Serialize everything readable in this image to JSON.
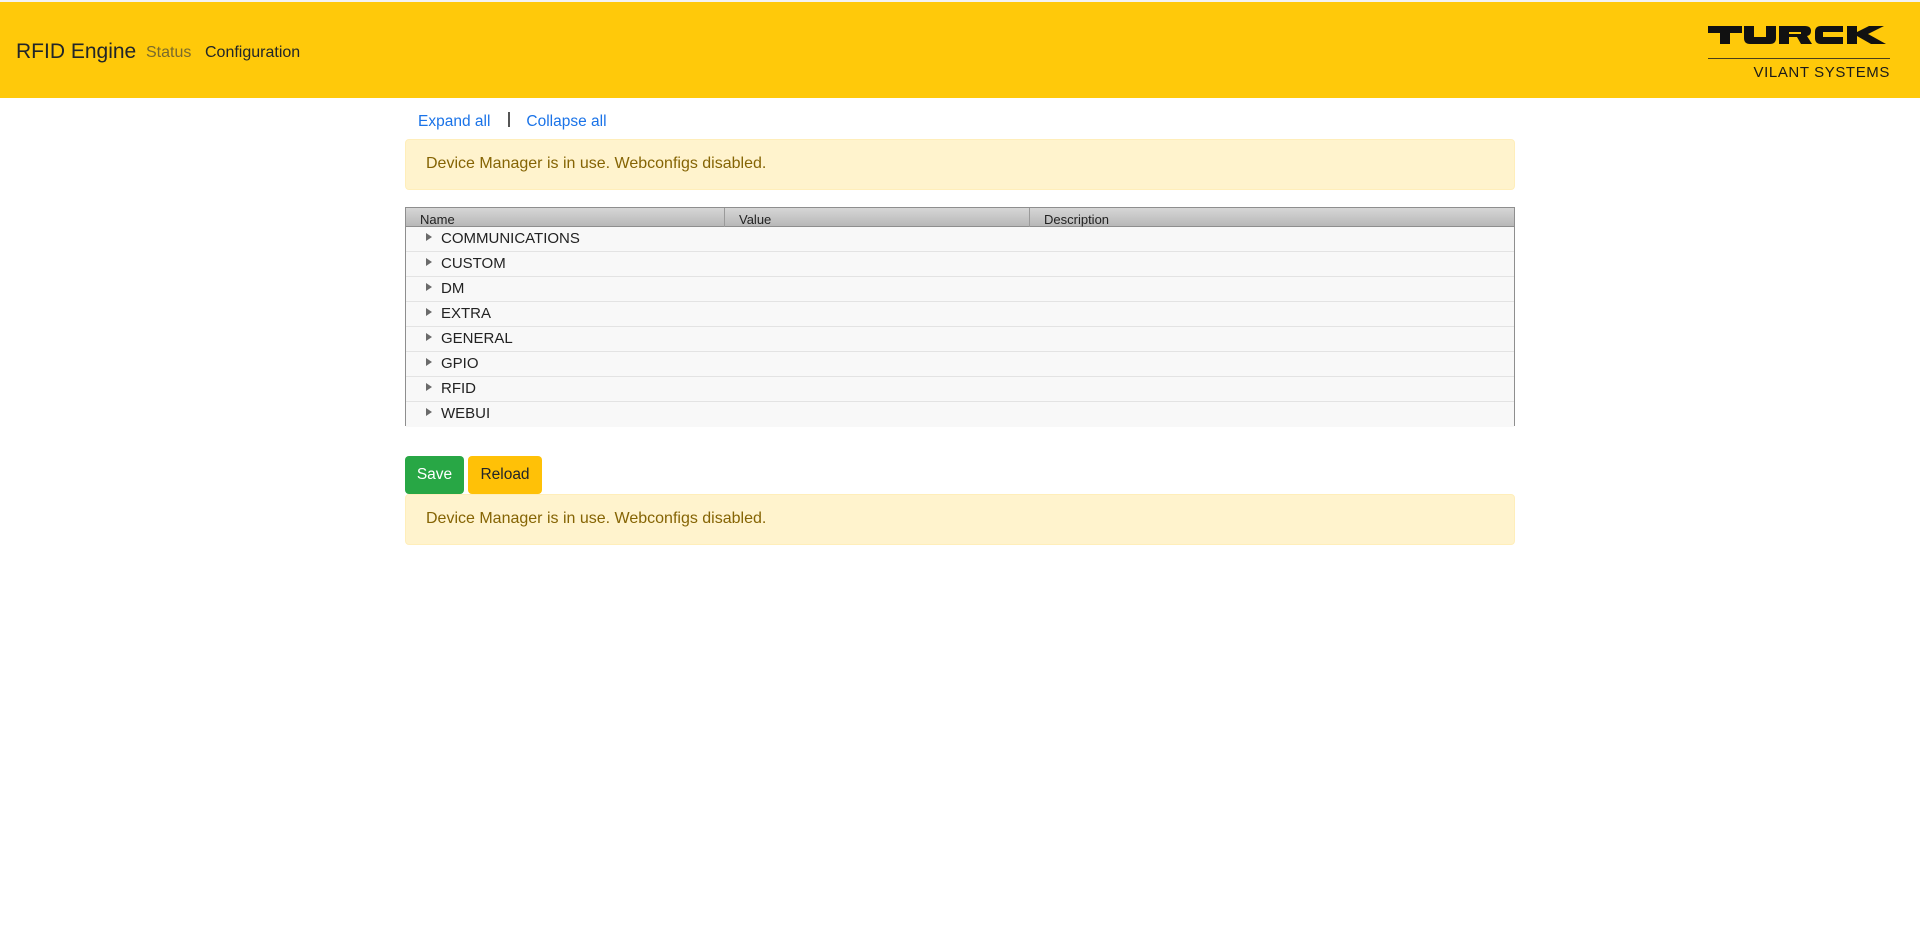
{
  "header": {
    "brand": "RFID Engine",
    "nav": [
      {
        "label": "Status",
        "active": false
      },
      {
        "label": "Configuration",
        "active": true
      }
    ],
    "logo": {
      "wordmark": "TURCK",
      "subtitle": "VILANT SYSTEMS"
    },
    "background_color": "#ffc90a"
  },
  "toolbar": {
    "expand_all": "Expand all",
    "collapse_all": "Collapse all"
  },
  "alerts": {
    "top": "Device Manager is in use. Webconfigs disabled.",
    "bottom": "Device Manager is in use. Webconfigs disabled."
  },
  "grid": {
    "columns": [
      "Name",
      "Value",
      "Description"
    ],
    "rows": [
      {
        "name": "COMMUNICATIONS",
        "expanded": false
      },
      {
        "name": "CUSTOM",
        "expanded": false
      },
      {
        "name": "DM",
        "expanded": false
      },
      {
        "name": "EXTRA",
        "expanded": false
      },
      {
        "name": "GENERAL",
        "expanded": false
      },
      {
        "name": "GPIO",
        "expanded": false
      },
      {
        "name": "RFID",
        "expanded": false
      },
      {
        "name": "WEBUI",
        "expanded": false
      }
    ]
  },
  "actions": {
    "save_label": "Save",
    "reload_label": "Reload",
    "save_color": "#28a745",
    "reload_color": "#ffc107"
  }
}
